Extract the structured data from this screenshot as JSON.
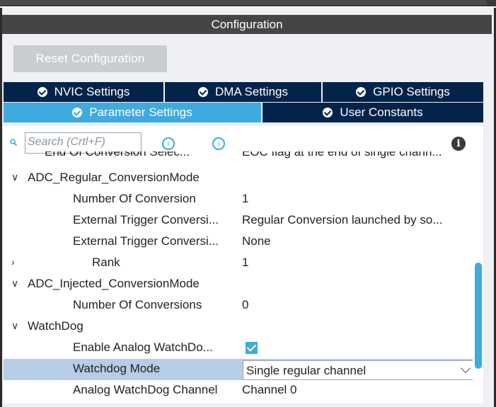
{
  "window": {
    "title": "Configuration"
  },
  "reset_label": "Reset Configuration",
  "tabs_row1": [
    {
      "label": "NVIC Settings"
    },
    {
      "label": "DMA Settings"
    },
    {
      "label": "GPIO Settings"
    }
  ],
  "tabs_row2": [
    {
      "label": "Parameter Settings",
      "active": true
    },
    {
      "label": "User Constants"
    }
  ],
  "search": {
    "placeholder": "Search (Crtl+F)",
    "prev_icon": "chevron-left-circle",
    "next_icon": "chevron-right-circle"
  },
  "partial_row": {
    "name": "End Of Conversion Selec...",
    "value": "EOC flag at the end of single chann..."
  },
  "groups": [
    {
      "label": "ADC_Regular_ConversionMode",
      "items": [
        {
          "name": "Number Of Conversion",
          "value": "1"
        },
        {
          "name": "External Trigger Conversi...",
          "value": "Regular Conversion launched by so..."
        },
        {
          "name": "External Trigger Conversi...",
          "value": "None"
        },
        {
          "name": "Rank",
          "value": "1"
        }
      ]
    },
    {
      "label": "ADC_Injected_ConversionMode",
      "items": [
        {
          "name": "Number Of Conversions",
          "value": "0"
        }
      ]
    },
    {
      "label": "WatchDog",
      "items": [
        {
          "name": "Enable Analog WatchDo...",
          "checked": true
        },
        {
          "name": "Watchdog Mode",
          "value": "Single regular channel",
          "selected": true
        },
        {
          "name": "Analog WatchDog Channel",
          "value": "Channel 0"
        }
      ]
    }
  ],
  "colors": {
    "accent": "#3eaadf",
    "tab_bg": "#03234b",
    "header_bg": "#454545",
    "selected_row": "#b7cde6"
  }
}
